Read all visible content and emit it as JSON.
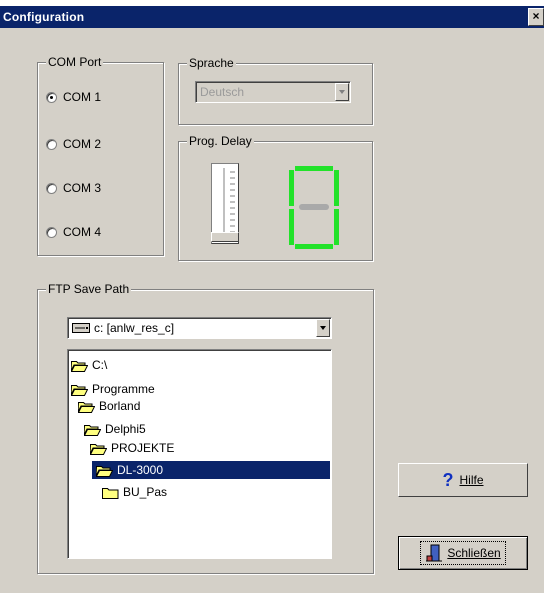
{
  "window": {
    "title": "Configuration",
    "close_glyph": "×"
  },
  "com_port": {
    "legend": "COM Port",
    "options": [
      {
        "label": "COM 1",
        "selected": true
      },
      {
        "label": "COM 2",
        "selected": false
      },
      {
        "label": "COM 3",
        "selected": false
      },
      {
        "label": "COM 4",
        "selected": false
      }
    ]
  },
  "sprache": {
    "legend": "Sprache",
    "value": "Deutsch"
  },
  "prog_delay": {
    "legend": "Prog. Delay",
    "display_digit": "0"
  },
  "ftp": {
    "legend": "FTP Save Path",
    "drive": "c: [anlw_res_c]",
    "folders": [
      {
        "name": "C:\\",
        "open": true
      },
      {
        "name": "Programme",
        "open": true
      },
      {
        "name": "Borland",
        "open": true
      },
      {
        "name": "Delphi5",
        "open": true
      },
      {
        "name": "PROJEKTE",
        "open": true
      },
      {
        "name": "DL-3000",
        "open": true,
        "selected": true
      },
      {
        "name": "BU_Pas",
        "open": false
      }
    ]
  },
  "buttons": {
    "help": {
      "label": "Hilfe",
      "icon": "question-icon"
    },
    "close": {
      "label": "Schließen",
      "icon": "door-exit-icon"
    }
  },
  "colors": {
    "titlebar": "#0a246a",
    "face": "#d4d0c8",
    "led": "#22e22a",
    "selection": "#0a246a"
  }
}
